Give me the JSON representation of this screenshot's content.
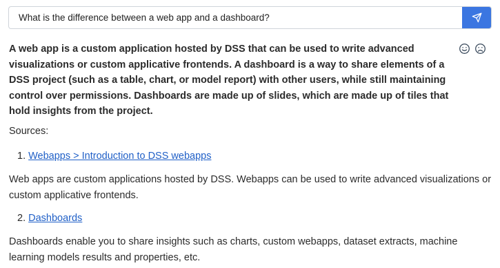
{
  "query": {
    "value": "What is the difference between a web app and a dashboard?"
  },
  "icons": {
    "send": "send-icon",
    "thumbs_up": "smile-icon",
    "thumbs_down": "frown-icon"
  },
  "colors": {
    "accent": "#3b76e1",
    "link": "#1f5fc7"
  },
  "answer": {
    "text": "A web app is a custom application hosted by DSS that can be used to write advanced visualizations or custom applicative frontends. A dashboard is a way to share elements of a DSS project (such as a table, chart, or model report) with other users, while still maintaining control over permissions. Dashboards are made up of slides, which are made up of tiles that hold insights from the project."
  },
  "sources": {
    "label": "Sources:",
    "items": [
      {
        "number": "1.",
        "title": "Webapps > Introduction to DSS webapps",
        "excerpt": "Web apps are custom applications hosted by DSS. Webapps can be used to write advanced visualizations or custom applicative frontends."
      },
      {
        "number": "2.",
        "title": "Dashboards",
        "excerpt": "Dashboards enable you to share insights such as charts, custom webapps, dataset extracts, machine learning models results and properties, etc."
      }
    ]
  }
}
